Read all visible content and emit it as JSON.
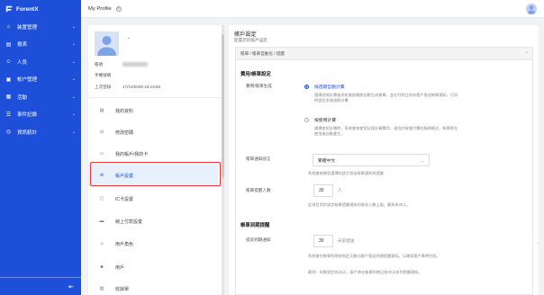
{
  "app": {
    "brand": "ForentX"
  },
  "sidebar": {
    "items": [
      {
        "label": "装置管理",
        "icon": "home-icon",
        "glyph": "⌂",
        "chev": "⌄"
      },
      {
        "label": "报表",
        "icon": "chart-icon",
        "glyph": "▤",
        "chev": "⌄"
      },
      {
        "label": "人员",
        "icon": "user-icon",
        "glyph": "☺",
        "chev": "⌄"
      },
      {
        "label": "帐户管理",
        "icon": "folder-icon",
        "glyph": "▣",
        "chev": "⌄"
      },
      {
        "label": "活動",
        "icon": "calendar-icon",
        "glyph": "▦",
        "chev": "⌄"
      },
      {
        "label": "事件記錄",
        "icon": "list-icon",
        "glyph": "☰",
        "chev": "⌄"
      },
      {
        "label": "資訊統計",
        "icon": "globe-icon",
        "glyph": "◎",
        "chev": "⌄"
      }
    ],
    "collapse_glyph": "⇤"
  },
  "topbar": {
    "title": "My Profile"
  },
  "profile": {
    "name": "-",
    "fields": [
      {
        "label": "帳號",
        "value": ""
      },
      {
        "label": "手機號碼",
        "value": ""
      },
      {
        "label": "上次登錄",
        "value": "17/10/2020 15:13:50"
      }
    ],
    "menu": [
      {
        "label": "我的資料",
        "icon": "profile-icon",
        "glyph": "▤"
      },
      {
        "label": "修改密碼",
        "icon": "lock-icon",
        "glyph": "⊟"
      },
      {
        "label": "我的帳戶/我的卡",
        "icon": "card-icon",
        "glyph": "▭"
      },
      {
        "label": "帳戶設置",
        "icon": "settings-icon",
        "glyph": "⚙"
      },
      {
        "label": "IC卡設置",
        "icon": "chip-icon",
        "glyph": "▢"
      },
      {
        "label": "線上付款設置",
        "icon": "payment-icon",
        "glyph": "▬"
      },
      {
        "label": "用戶角色",
        "icon": "role-icon",
        "glyph": "☺"
      },
      {
        "label": "用戶",
        "icon": "person-icon",
        "glyph": "☻"
      },
      {
        "label": "收據單",
        "icon": "receipt-icon",
        "glyph": "▥"
      }
    ]
  },
  "settings": {
    "title": "帳戶設定",
    "subtitle": "配置您的帳戶設定",
    "tab": "帳單 / 帳單自動化 / 提醒",
    "billing": {
      "section": "費用/帳單設定",
      "label": "費用/帳單生成",
      "opt1": "按週期自動計費",
      "opt1_desc": "選擇週期計費後系統會按帳期自動生成帳單，並在付款日前向客戶發送帳單通知，可同時設定多個週期計費",
      "opt2": "按使用計費",
      "opt2_desc": "選擇使用計費時，系統會按使用記錄計算費用，適用於按量付費的服務模式，帳單將在使用後自動產生。"
    },
    "lang": {
      "label": "帳單通知語言",
      "value": "繁體中文",
      "hint": "系統會根據您選擇的語言發送帳單通知與提醒"
    },
    "count": {
      "label": "帳單提醒人數",
      "value": "30",
      "unit": "人",
      "hint": "此項目用於設定帳單提醒通知的發送人數上限，最高為30人。"
    },
    "reminder": {
      "section": "帳單到期提醒",
      "label": "提前到期通知",
      "value": "30",
      "unit": "天前發送",
      "hint1": "系統會在帳單到期前指定天數向客戶發送到期提醒通知，以確保客戶準時付款。",
      "hint2": "範例：如果設定為30天，客戶將在帳單到期日前30天收到提醒通知。"
    }
  }
}
